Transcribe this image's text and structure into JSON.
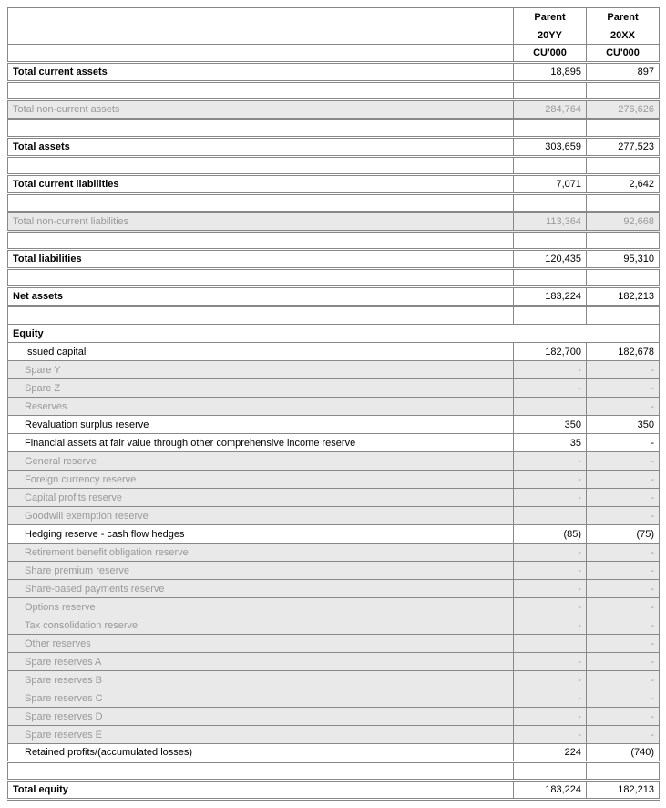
{
  "headers": {
    "col1_top": "Parent",
    "col2_top": "Parent",
    "col1_year": "20YY",
    "col2_year": "20XX",
    "col1_unit": "CU'000",
    "col2_unit": "CU'000"
  },
  "rows": {
    "tca": {
      "label": "Total current assets",
      "v1": "18,895",
      "v2": "897"
    },
    "tnca": {
      "label": "Total non-current assets",
      "v1": "284,764",
      "v2": "276,626"
    },
    "ta": {
      "label": "Total assets",
      "v1": "303,659",
      "v2": "277,523"
    },
    "tcl": {
      "label": "Total current liabilities",
      "v1": "7,071",
      "v2": "2,642"
    },
    "tncl": {
      "label": "Total non-current liabilities",
      "v1": "113,364",
      "v2": "92,668"
    },
    "tl": {
      "label": "Total liabilities",
      "v1": "120,435",
      "v2": "95,310"
    },
    "na": {
      "label": "Net assets",
      "v1": "183,224",
      "v2": "182,213"
    },
    "eq": {
      "label": "Equity"
    },
    "ic": {
      "label": "Issued capital",
      "v1": "182,700",
      "v2": "182,678"
    },
    "sy": {
      "label": "Spare Y",
      "v1": "-",
      "v2": "-"
    },
    "sz": {
      "label": "Spare Z",
      "v1": "-",
      "v2": "-"
    },
    "res": {
      "label": "Reserves",
      "v1": "",
      "v2": "-"
    },
    "rsr": {
      "label": "Revaluation surplus reserve",
      "v1": "350",
      "v2": "350"
    },
    "fav": {
      "label": "Financial assets at fair value through other comprehensive income reserve",
      "v1": "35",
      "v2": "-"
    },
    "gr": {
      "label": "General reserve",
      "v1": "-",
      "v2": "-"
    },
    "fcr": {
      "label": "Foreign currency reserve",
      "v1": "-",
      "v2": "-"
    },
    "cpr": {
      "label": "Capital profits reserve",
      "v1": "-",
      "v2": "-"
    },
    "ger": {
      "label": "Goodwill exemption reserve",
      "v1": "",
      "v2": "-"
    },
    "hr": {
      "label": "Hedging reserve - cash flow hedges",
      "v1": "(85)",
      "v2": "(75)"
    },
    "rbor": {
      "label": "Retirement benefit obligation reserve",
      "v1": "-",
      "v2": "-"
    },
    "spr": {
      "label": "Share premium reserve",
      "v1": "-",
      "v2": "-"
    },
    "sbpr": {
      "label": "Share-based payments reserve",
      "v1": "-",
      "v2": "-"
    },
    "or": {
      "label": "Options reserve",
      "v1": "-",
      "v2": "-"
    },
    "tcr": {
      "label": "Tax consolidation reserve",
      "v1": "-",
      "v2": "-"
    },
    "other": {
      "label": "Other reserves",
      "v1": "",
      "v2": "-"
    },
    "sra": {
      "label": "Spare reserves A",
      "v1": "-",
      "v2": "-"
    },
    "srb": {
      "label": "Spare reserves B",
      "v1": "-",
      "v2": "-"
    },
    "src": {
      "label": "Spare reserves C",
      "v1": "-",
      "v2": "-"
    },
    "srd": {
      "label": "Spare reserves D",
      "v1": "-",
      "v2": "-"
    },
    "sre": {
      "label": "Spare reserves E",
      "v1": "-",
      "v2": "-"
    },
    "rp": {
      "label": "Retained profits/(accumulated losses)",
      "v1": "224",
      "v2": "(740)"
    },
    "te": {
      "label": "Total equity",
      "v1": "183,224",
      "v2": "182,213"
    }
  }
}
